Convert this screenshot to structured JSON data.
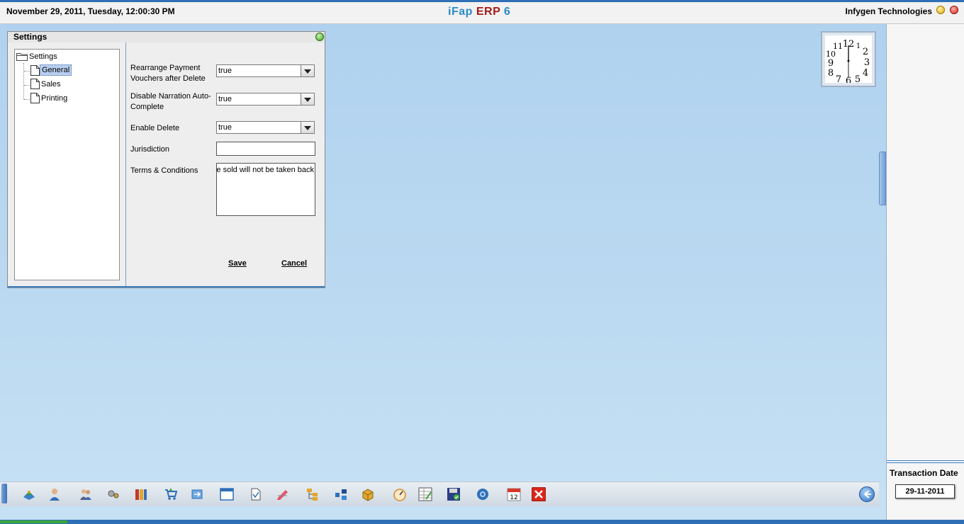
{
  "header": {
    "datetime": "November  29, 2011, Tuesday, 12:00:30 PM",
    "title_part1": "iFap ",
    "title_part2": "ERP",
    "title_part3": " 6",
    "company": "Infygen Technologies"
  },
  "settings_window": {
    "title": "Settings",
    "tree": {
      "root": "Settings",
      "items": [
        "General",
        "Sales",
        "Printing"
      ],
      "selected": "General"
    },
    "fields": {
      "rearrange_label": "Rearrange Payment Vouchers after Delete",
      "rearrange_value": "true",
      "narration_label": "Disable Narration Auto-Complete",
      "narration_value": "true",
      "delete_label": "Enable Delete",
      "delete_value": "true",
      "jurisdiction_label": "Jurisdiction",
      "jurisdiction_value": "",
      "terms_label": "Terms & Conditions",
      "terms_value": "e sold will not be taken back"
    },
    "buttons": {
      "save": "Save",
      "cancel": "Cancel"
    }
  },
  "right_panel": {
    "transaction_date_label": "Transaction Date",
    "transaction_date_value": "29-11-2011"
  },
  "clock": {
    "numbers": [
      "12",
      "1",
      "2",
      "3",
      "4",
      "5",
      "6",
      "7",
      "8",
      "9",
      "10",
      "11"
    ]
  },
  "taskbar": {
    "icons": [
      "map-icon",
      "user-icon",
      "group-icon",
      "gear-cog-icon",
      "books-icon",
      "cart-icon",
      "transfer-icon",
      "window-icon",
      "document-icon",
      "edit-icon",
      "tree-icon",
      "network-icon",
      "box-icon",
      "dashboard-icon",
      "spreadsheet-icon",
      "save-disk-icon",
      "settings-icon",
      "calendar-icon",
      "exit-icon"
    ],
    "calendar_day": "12"
  },
  "colors": {
    "accent_blue": "#2f6fb6",
    "title_blue": "#2a8bc8",
    "title_red": "#a31b1b",
    "desktop_bg": "#bcd9ef"
  }
}
